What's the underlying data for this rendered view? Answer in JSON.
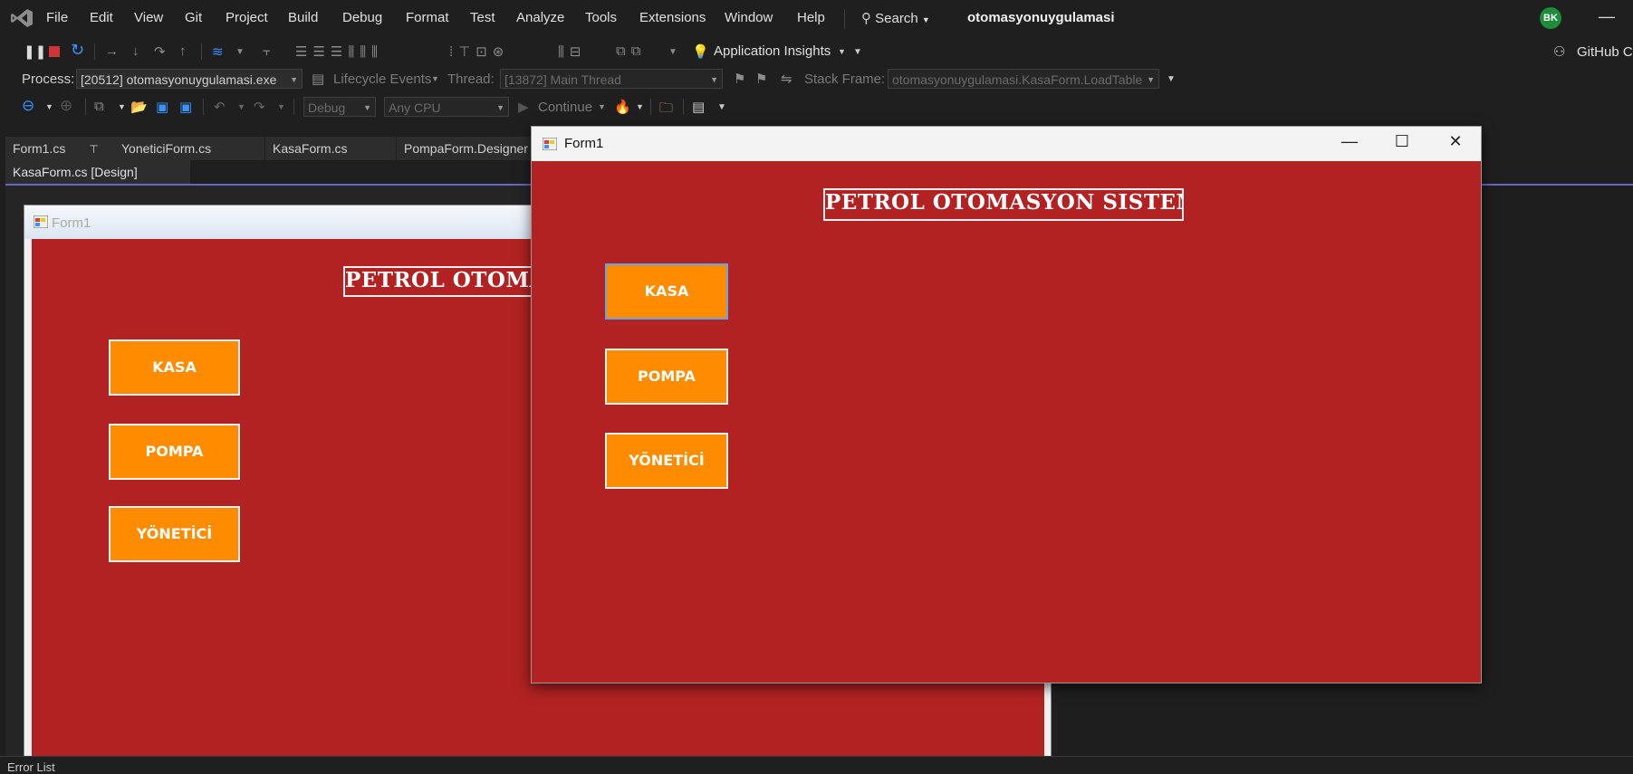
{
  "menubar": {
    "items": [
      "File",
      "Edit",
      "View",
      "Git",
      "Project",
      "Build",
      "Debug",
      "Format",
      "Test",
      "Analyze",
      "Tools",
      "Extensions",
      "Window",
      "Help"
    ],
    "search_label": "Search",
    "solution_name": "otomasyonuygulamasi",
    "user_initials": "BK",
    "minimize": "—"
  },
  "toolbar1": {
    "app_insights": "Application Insights",
    "github": "GitHub C"
  },
  "debug_bar": {
    "process_label": "Process:",
    "process_value": "[20512] otomasyonuygulamasi.exe",
    "lifecycle_label": "Lifecycle Events",
    "thread_label": "Thread:",
    "thread_value": "[13872] Main Thread",
    "stack_label": "Stack Frame:",
    "stack_value": "otomasyonuygulamasi.KasaForm.LoadTable"
  },
  "toolbar3": {
    "config": "Debug",
    "platform": "Any CPU",
    "continue_label": "Continue"
  },
  "tabs": {
    "row1": [
      "Form1.cs",
      "YoneticiForm.cs",
      "KasaForm.cs",
      "PompaForm.Designer"
    ],
    "row2": "KasaForm.cs [Design]"
  },
  "designer": {
    "form_title": "Form1",
    "banner": "PETROL OTOMASYON SISTEMI",
    "buttons": [
      "KASA",
      "POMPA",
      "YÖNETİCİ"
    ]
  },
  "running_form": {
    "title": "Form1",
    "banner": "PETROL OTOMASYON SISTEMI",
    "buttons": [
      "KASA",
      "POMPA",
      "YÖNETİCİ"
    ],
    "ctrl_min": "—",
    "ctrl_max": "☐",
    "ctrl_close": "✕"
  },
  "bottom": {
    "label": "Error List"
  },
  "colors": {
    "form_red": "#b22222",
    "button_orange": "#ff8c00",
    "accent_purple": "#6b63c9"
  }
}
